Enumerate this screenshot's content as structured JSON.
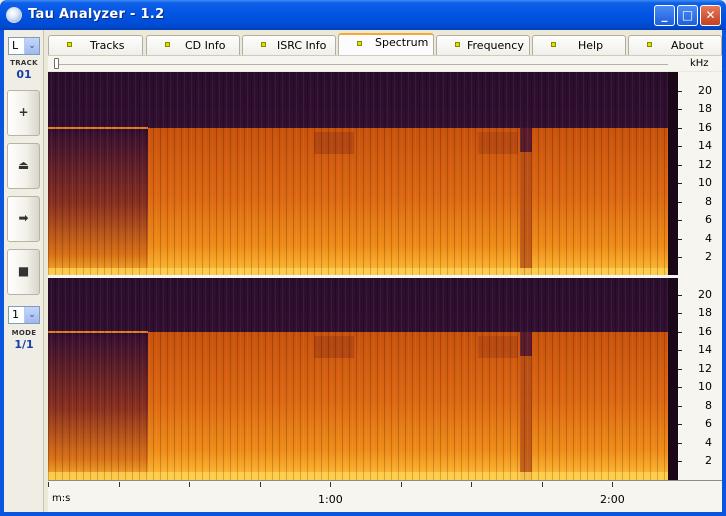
{
  "window": {
    "title": "Tau Analyzer - 1.2",
    "minimize_glyph": "_",
    "maximize_glyph": "□",
    "close_glyph": "✕"
  },
  "left_panel": {
    "channel_select": "L",
    "track_label": "TRACK",
    "track_value": "01",
    "buttons": {
      "plus_glyph": "+",
      "eject_glyph": "⏏",
      "play_glyph": "➡",
      "stop_glyph": "■"
    },
    "mode_select": "1",
    "mode_label": "MODE",
    "mode_value": "1/1",
    "dropdown_glyph": "⌄"
  },
  "tabs": [
    {
      "label": "Tracks",
      "active": false
    },
    {
      "label": "CD Info",
      "active": false
    },
    {
      "label": "ISRC Info",
      "active": false
    },
    {
      "label": "Spectrum",
      "active": true
    },
    {
      "label": "Frequency",
      "active": false
    },
    {
      "label": "Help",
      "active": false
    },
    {
      "label": "About",
      "active": false
    }
  ],
  "spectrum": {
    "freq_unit": "kHz",
    "freq_ticks": [
      "20",
      "18",
      "16",
      "14",
      "12",
      "10",
      "8",
      "6",
      "4",
      "2"
    ],
    "time_unit": "m:s",
    "time_labels": [
      "1:00",
      "2:00"
    ],
    "colors": {
      "background": "#2a0e2e",
      "high_band": "#3a1138",
      "mid": "#d8600e",
      "low": "#f39a18",
      "bottom": "#ffc43a"
    }
  }
}
